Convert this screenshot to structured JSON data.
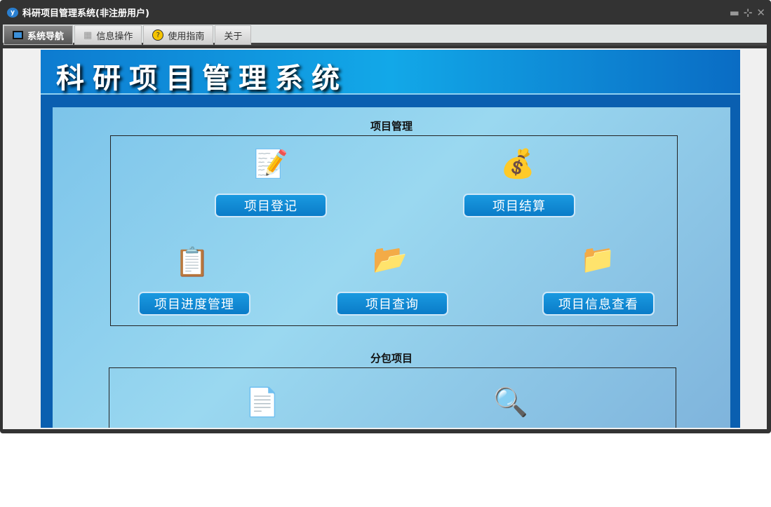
{
  "window": {
    "title": "科研项目管理系统(非注册用户)",
    "logo_text": "y"
  },
  "tabs": [
    {
      "label": "系统导航",
      "icon": "monitor-icon"
    },
    {
      "label": "信息操作",
      "icon": "grid-icon"
    },
    {
      "label": "使用指南",
      "icon": "help-icon"
    },
    {
      "label": "关于"
    }
  ],
  "banner": {
    "title": "科研项目管理系统"
  },
  "groups": [
    {
      "title": "项目管理",
      "buttons": [
        "项目登记",
        "项目结算",
        "项目进度管理",
        "项目查询",
        "项目信息查看"
      ]
    },
    {
      "title": "分包项目"
    }
  ]
}
